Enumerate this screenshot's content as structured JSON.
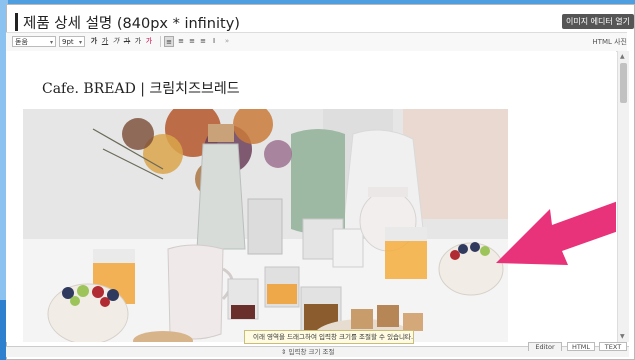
{
  "header": {
    "title": "제품 상세 설명 (840px * infinity)",
    "image_editor_button": "이미지 에디터 열기"
  },
  "toolbar": {
    "font_select": "돋움",
    "size_select": "9pt",
    "buttons": [
      "가",
      "가",
      "가",
      "가",
      "가",
      "가",
      "≡",
      "≡",
      "≡",
      "≡",
      "I",
      "»"
    ],
    "right_button": "HTML 사진"
  },
  "content": {
    "store_heading": "Cafe. BREAD | 크림치즈브레드"
  },
  "tooltip": {
    "text": "이래 영역을 드래그하여 입력창 크기를 조절할 수 있습니다.",
    "close": "✕"
  },
  "footer": {
    "resize_label": "⇕ 입력창 크기 조절",
    "modes": [
      "Editor",
      "HTML",
      "TEXT"
    ]
  },
  "colors": {
    "accent_arrow": "#e8327a",
    "background": "#4f9fe0"
  }
}
